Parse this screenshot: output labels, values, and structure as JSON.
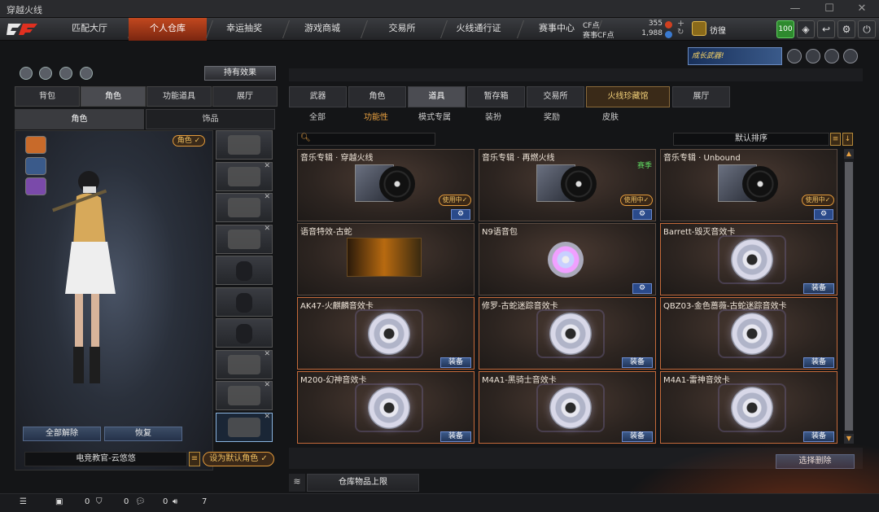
{
  "window": {
    "title": "穿越火线"
  },
  "topnav": {
    "tabs": [
      "匹配大厅",
      "个人仓库",
      "幸运抽奖",
      "游戏商城",
      "交易所",
      "火线通行证",
      "赛事中心"
    ],
    "active_tab": "个人仓库",
    "cf_label": "CF点",
    "cf_value": "355",
    "event_cf_label": "赛事CF点",
    "event_cf_value": "1,988",
    "player_name": "彷徨",
    "level": "100"
  },
  "left": {
    "effect_button": "持有效果",
    "tabs": [
      "背包",
      "角色",
      "功能道具",
      "展厅"
    ],
    "active_tab": "角色",
    "subtabs": [
      "角色",
      "饰品"
    ],
    "active_subtab": "角色",
    "role_tag": "角色 ✓",
    "clear_all": "全部解除",
    "restore": "恢复",
    "preset_name": "电竞教官-云悠悠",
    "set_default": "设为默认角色 ✓"
  },
  "right": {
    "promo": "成长武器!",
    "tabs": [
      "武器",
      "角色",
      "道具",
      "暂存箱",
      "交易所",
      "火线珍藏馆",
      "展厅"
    ],
    "active_tab": "道具",
    "category_tabs": [
      "全部",
      "功能性",
      "模式专属",
      "装扮",
      "奖励",
      "皮肤"
    ],
    "active_category": "功能性",
    "search_placeholder": "",
    "sort_label": "默认排序",
    "items": [
      {
        "name": "音乐专辑 · 穿越火线",
        "type": "album",
        "status": "使用中✓",
        "action": "gear"
      },
      {
        "name": "音乐专辑 · 再燃火线",
        "type": "album",
        "badge": "赛季",
        "status": "使用中✓",
        "action": "gear"
      },
      {
        "name": "音乐专辑 · Unbound",
        "type": "album",
        "status": "使用中✓",
        "action": "gear"
      },
      {
        "name": "语音特效-古蛇",
        "type": "voice"
      },
      {
        "name": "N9语音包",
        "type": "n9",
        "action": "gear"
      },
      {
        "name": "Barrett-毁灭音效卡",
        "type": "card",
        "action": "装备"
      },
      {
        "name": "AK47-火麒麟音效卡",
        "type": "card",
        "action": "装备"
      },
      {
        "name": "修罗-古蛇迷踪音效卡",
        "type": "card",
        "action": "装备"
      },
      {
        "name": "QBZ03-金色蔷薇-古蛇迷踪音效卡",
        "type": "card",
        "action": "装备"
      },
      {
        "name": "M200-幻神音效卡",
        "type": "card",
        "action": "装备"
      },
      {
        "name": "M4A1-黑骑士音效卡",
        "type": "card",
        "action": "装备"
      },
      {
        "name": "M4A1-雷神音效卡",
        "type": "card",
        "action": "装备"
      }
    ],
    "select_delete": "选择删除",
    "limit_label": "仓库物品上限"
  },
  "statusbar": {
    "count1": "0",
    "count2": "0",
    "count3": "0",
    "count4": "7"
  }
}
